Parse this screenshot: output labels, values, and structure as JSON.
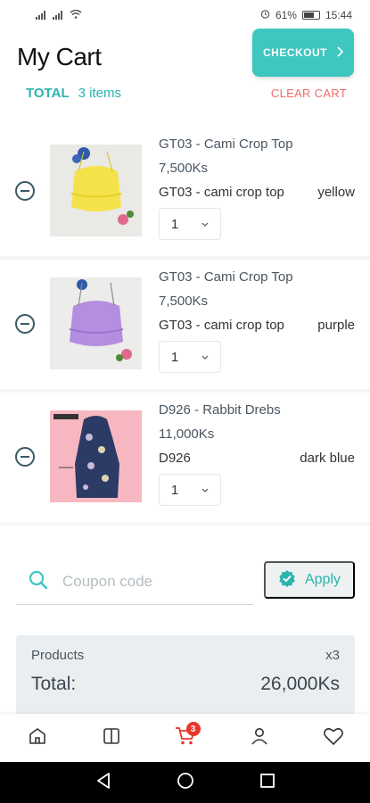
{
  "status_bar": {
    "battery_percent": "61%",
    "time": "15:44"
  },
  "header": {
    "title": "My Cart",
    "checkout_label": "CHECKOUT",
    "total_label": "TOTAL",
    "items_count": "3 items",
    "clear_cart_label": "CLEAR CART"
  },
  "cart": {
    "items": [
      {
        "name": "GT03 - Cami Crop Top",
        "price": "7,500Ks",
        "variant_code": "GT03 - cami crop top",
        "color": "yellow",
        "quantity": "1",
        "swatch": "#f5e24a"
      },
      {
        "name": "GT03 - Cami Crop Top",
        "price": "7,500Ks",
        "variant_code": "GT03 - cami crop top",
        "color": "purple",
        "quantity": "1",
        "swatch": "#b48ee0"
      },
      {
        "name": "D926 - Rabbit Drebs",
        "price": "11,000Ks",
        "variant_code": "D926",
        "color": "dark blue",
        "quantity": "1",
        "swatch": "#2c3a66"
      }
    ]
  },
  "coupon": {
    "placeholder": "Coupon code",
    "apply_label": "Apply"
  },
  "summary": {
    "products_label": "Products",
    "products_count": "x3",
    "total_label": "Total:",
    "total_value": "26,000Ks"
  },
  "bottom_nav": {
    "items": [
      {
        "icon": "home-icon"
      },
      {
        "icon": "catalog-icon"
      },
      {
        "icon": "cart-icon",
        "badge": "3"
      },
      {
        "icon": "profile-icon"
      },
      {
        "icon": "heart-icon"
      }
    ]
  },
  "colors": {
    "accent": "#3ec6c0",
    "danger": "#f06b6b",
    "badge": "#e8372a"
  }
}
